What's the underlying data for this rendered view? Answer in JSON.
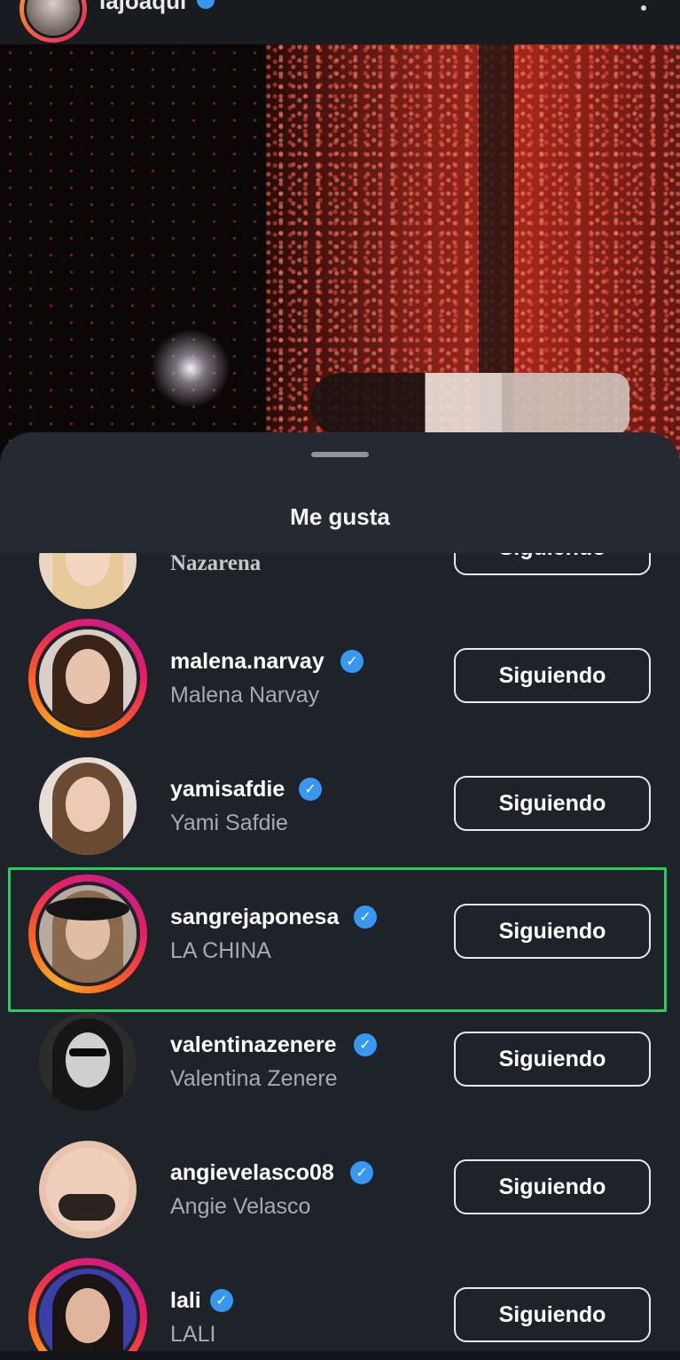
{
  "post": {
    "username": "lajoaqui",
    "more_icon": "more-icon"
  },
  "sheet": {
    "title": "Me gusta"
  },
  "likes": [
    {
      "username": "",
      "name": "Nazarena",
      "verified": false,
      "button": "Siguiendo",
      "story_ring": false
    },
    {
      "username": "malena.narvay",
      "name": "Malena Narvay",
      "verified": true,
      "button": "Siguiendo",
      "story_ring": true
    },
    {
      "username": "yamisafdie",
      "name": "Yami Safdie",
      "verified": true,
      "button": "Siguiendo",
      "story_ring": false
    },
    {
      "username": "sangrejaponesa",
      "name": "LA CHINA",
      "verified": true,
      "button": "Siguiendo",
      "story_ring": true
    },
    {
      "username": "valentinazenere",
      "name": "Valentina Zenere",
      "verified": true,
      "button": "Siguiendo",
      "story_ring": false
    },
    {
      "username": "angievelasco08",
      "name": "Angie Velasco",
      "verified": true,
      "button": "Siguiendo",
      "story_ring": false
    },
    {
      "username": "lali",
      "name": "LALI",
      "verified": true,
      "button": "Siguiendo",
      "story_ring": true
    }
  ],
  "colors": {
    "background": "#1e2229",
    "verified_badge": "#3897f0",
    "highlight_border": "#22d15b",
    "secondary_text": "#a5abb3"
  }
}
